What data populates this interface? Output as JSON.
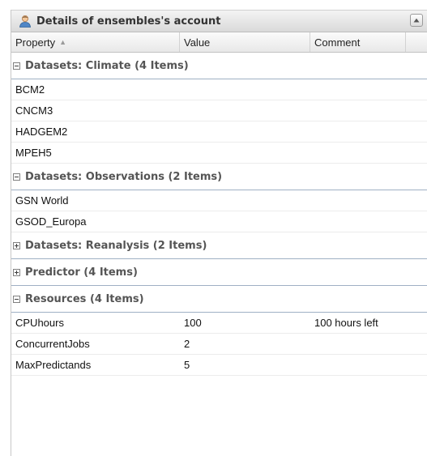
{
  "panel": {
    "title": "Details of ensembles's account"
  },
  "columns": {
    "property": "Property",
    "value": "Value",
    "comment": "Comment"
  },
  "groups": [
    {
      "label": "Datasets: Climate (4 Items)",
      "expanded": true,
      "rows": [
        {
          "property": "BCM2",
          "value": "",
          "comment": ""
        },
        {
          "property": "CNCM3",
          "value": "",
          "comment": ""
        },
        {
          "property": "HADGEM2",
          "value": "",
          "comment": ""
        },
        {
          "property": "MPEH5",
          "value": "",
          "comment": ""
        }
      ]
    },
    {
      "label": "Datasets: Observations (2 Items)",
      "expanded": true,
      "rows": [
        {
          "property": "GSN World",
          "value": "",
          "comment": ""
        },
        {
          "property": "GSOD_Europa",
          "value": "",
          "comment": ""
        }
      ]
    },
    {
      "label": "Datasets: Reanalysis (2 Items)",
      "expanded": false,
      "rows": []
    },
    {
      "label": "Predictor (4 Items)",
      "expanded": false,
      "rows": []
    },
    {
      "label": "Resources (4 Items)",
      "expanded": true,
      "rows": [
        {
          "property": "CPUhours",
          "value": "100",
          "comment": "100 hours left"
        },
        {
          "property": "ConcurrentJobs",
          "value": "2",
          "comment": ""
        },
        {
          "property": "MaxPredictands",
          "value": "5",
          "comment": ""
        }
      ]
    }
  ],
  "icons": {
    "title": "user-account-icon",
    "collapse": "collapse-up-icon",
    "sort": "sort-asc-icon"
  }
}
